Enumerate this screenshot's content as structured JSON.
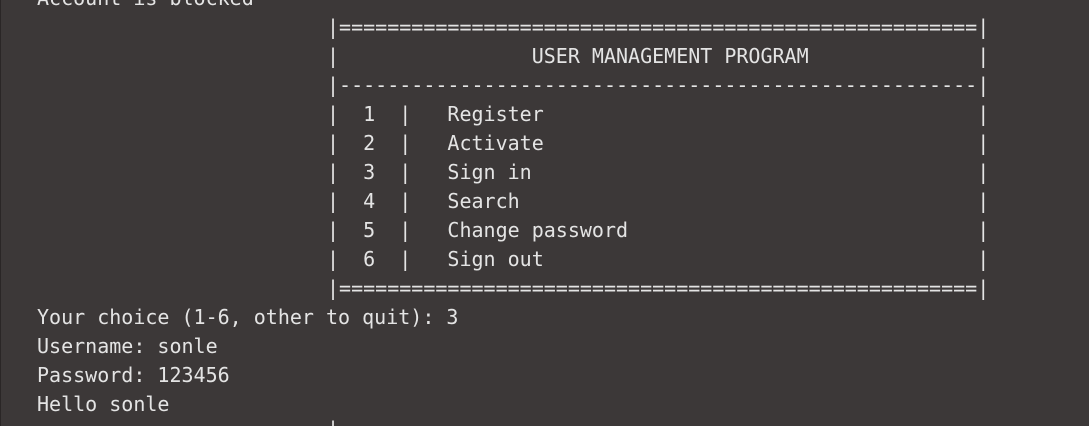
{
  "terminal": {
    "scrollback_partial": "Account is blocked",
    "menu_lines": [
      "|=====================================================|",
      "|                USER MANAGEMENT PROGRAM              |",
      "|-----------------------------------------------------|",
      "|  1  |   Register                                    |",
      "|  2  |   Activate                                    |",
      "|  3  |   Sign in                                     |",
      "|  4  |   Search                                      |",
      "|  5  |   Change password                             |",
      "|  6  |   Sign out                                    |",
      "|=====================================================|"
    ],
    "output_lines": [
      "Your choice (1-6, other to quit): 3",
      "Username: sonle",
      "Password: 123456",
      "Hello sonle"
    ],
    "bottom_partial": "|"
  }
}
